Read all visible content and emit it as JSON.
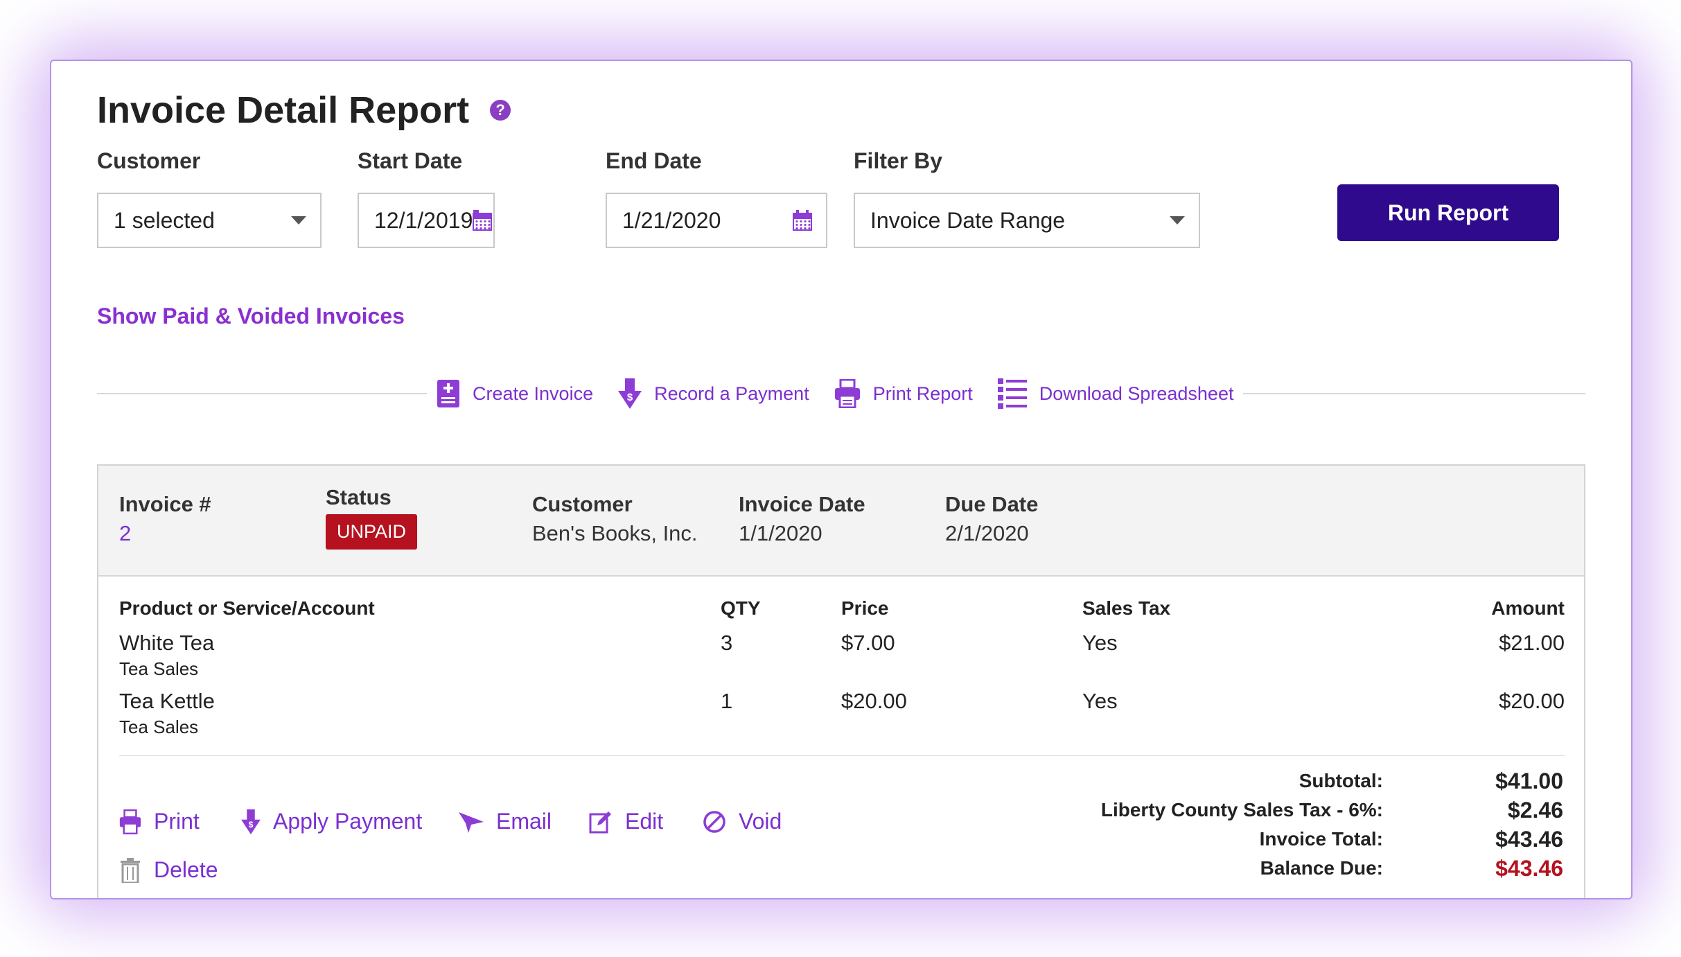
{
  "page": {
    "title": "Invoice Detail Report",
    "help_icon": "question-icon"
  },
  "filters": {
    "customer": {
      "label": "Customer",
      "value": "1 selected"
    },
    "start_date": {
      "label": "Start Date",
      "value": "12/1/2019"
    },
    "end_date": {
      "label": "End Date",
      "value": "1/21/2020"
    },
    "filter_by": {
      "label": "Filter By",
      "value": "Invoice Date Range"
    },
    "run_label": "Run Report"
  },
  "show_paid_link": "Show Paid & Voided Invoices",
  "actions": {
    "create": "Create Invoice",
    "record": "Record a Payment",
    "print": "Print Report",
    "download": "Download Spreadsheet"
  },
  "invoice": {
    "header": {
      "invoice_num_label": "Invoice #",
      "invoice_num": "2",
      "status_label": "Status",
      "status": "UNPAID",
      "customer_label": "Customer",
      "customer": "Ben's Books, Inc.",
      "invoice_date_label": "Invoice Date",
      "invoice_date": "1/1/2020",
      "due_date_label": "Due Date",
      "due_date": "2/1/2020"
    },
    "columns": {
      "product": "Product or Service/Account",
      "qty": "QTY",
      "price": "Price",
      "tax": "Sales Tax",
      "amount": "Amount"
    },
    "lines": [
      {
        "product": "White Tea",
        "account": "Tea Sales",
        "qty": "3",
        "price": "$7.00",
        "tax": "Yes",
        "amount": "$21.00"
      },
      {
        "product": "Tea Kettle",
        "account": "Tea Sales",
        "qty": "1",
        "price": "$20.00",
        "tax": "Yes",
        "amount": "$20.00"
      }
    ],
    "totals": {
      "subtotal_label": "Subtotal:",
      "subtotal": "$41.00",
      "tax_label": "Liberty County Sales Tax - 6%:",
      "tax": "$2.46",
      "total_label": "Invoice Total:",
      "total": "$43.46",
      "balance_label": "Balance Due:",
      "balance": "$43.46"
    },
    "actions": {
      "print": "Print",
      "apply_payment": "Apply Payment",
      "email": "Email",
      "edit": "Edit",
      "void": "Void",
      "delete": "Delete"
    }
  },
  "colors": {
    "accent": "#7b2fd0",
    "primary_button": "#2f0a8c",
    "unpaid": "#b5111e"
  }
}
